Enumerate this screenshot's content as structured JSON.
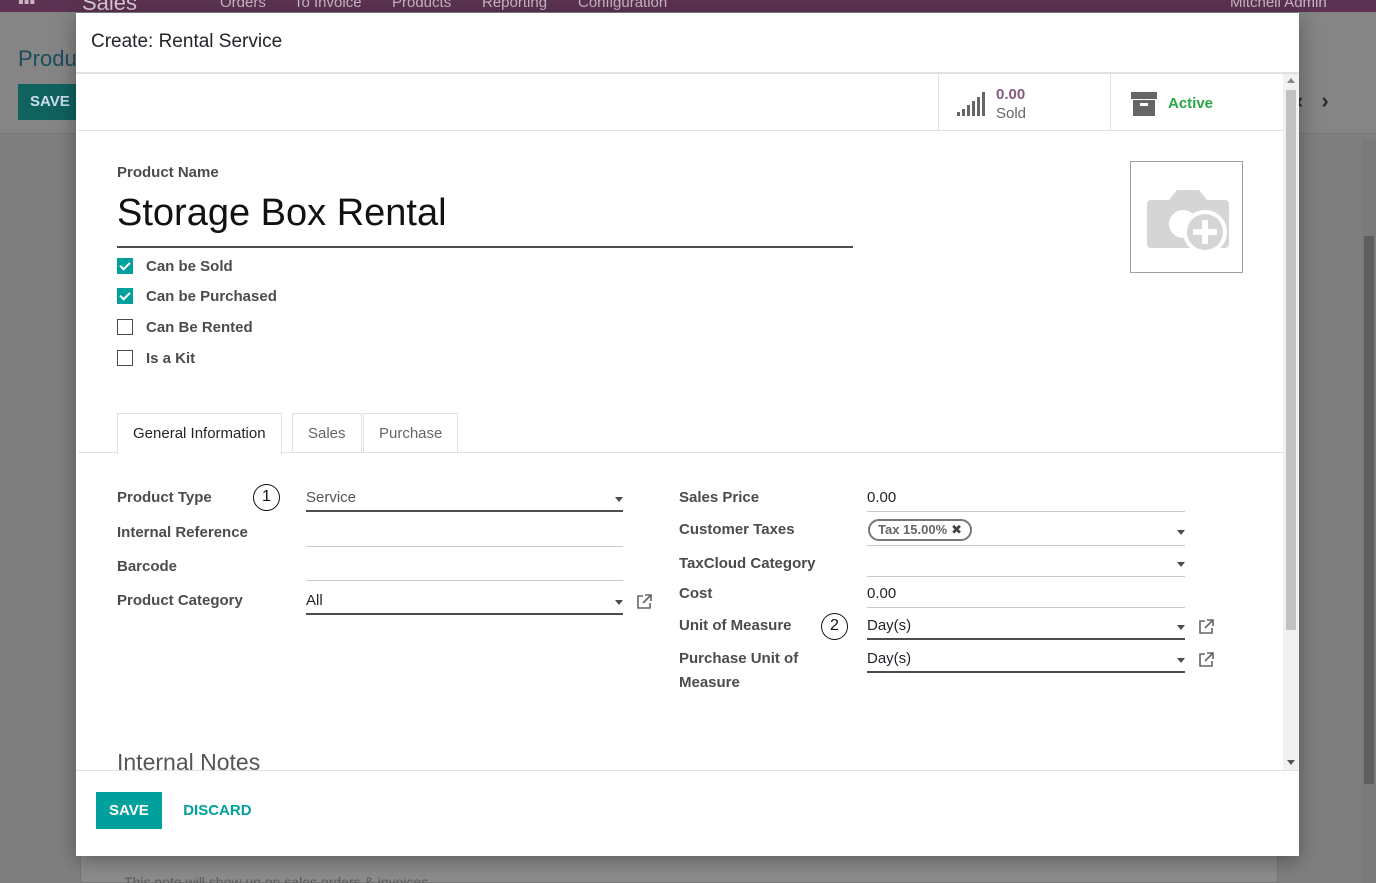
{
  "background": {
    "app_name": "Sales",
    "menu": [
      "Orders",
      "To Invoice",
      "Products",
      "Reporting",
      "Configuration"
    ],
    "user": "Mitchell Admin",
    "page_title": "Produ",
    "save_label": "SAVE",
    "sheet_text": "This note will show up on sales orders & invoices."
  },
  "modal": {
    "title": "Create: Rental Service",
    "stats": {
      "sold_value": "0.00",
      "sold_label": "Sold",
      "active_label": "Active"
    },
    "product_name_label": "Product Name",
    "product_name": "Storage Box Rental",
    "checkboxes": [
      {
        "label": "Can be Sold",
        "checked": true
      },
      {
        "label": "Can be Purchased",
        "checked": true
      },
      {
        "label": "Can Be Rented",
        "checked": false
      },
      {
        "label": "Is a Kit",
        "checked": false
      }
    ],
    "tabs": [
      "General Information",
      "Sales",
      "Purchase"
    ],
    "active_tab": "General Information",
    "left_fields": {
      "product_type_label": "Product Type",
      "product_type_value": "Service",
      "internal_reference_label": "Internal Reference",
      "internal_reference_value": "",
      "barcode_label": "Barcode",
      "barcode_value": "",
      "product_category_label": "Product Category",
      "product_category_value": "All"
    },
    "right_fields": {
      "sales_price_label": "Sales Price",
      "sales_price_value": "0.00",
      "customer_taxes_label": "Customer Taxes",
      "customer_tax_tag": "Tax 15.00%",
      "taxcloud_category_label": "TaxCloud Category",
      "taxcloud_category_value": "",
      "cost_label": "Cost",
      "cost_value": "0.00",
      "uom_label": "Unit of Measure",
      "uom_value": "Day(s)",
      "purchase_uom_label_1": "Purchase Unit of",
      "purchase_uom_label_2": "Measure",
      "purchase_uom_value": "Day(s)"
    },
    "annotations": {
      "marker_1": "1",
      "marker_2": "2"
    },
    "internal_notes_heading": "Internal Notes",
    "footer": {
      "save_label": "SAVE",
      "discard_label": "DISCARD"
    }
  },
  "colors": {
    "accent": "#00a09d",
    "brand": "#875a7b",
    "active": "#28a745"
  }
}
